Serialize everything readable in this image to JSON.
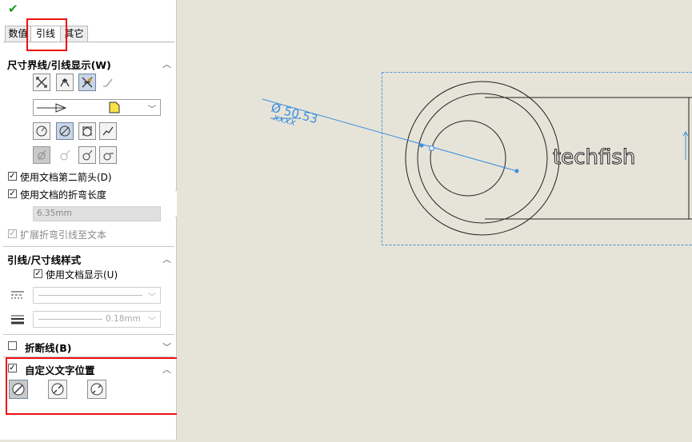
{
  "panel": {
    "ok_icon": "checkmark-icon",
    "tabs": [
      {
        "label": "数值"
      },
      {
        "label": "引线"
      },
      {
        "label": "其它"
      }
    ],
    "sec1": {
      "title": "尺寸界线/引线显示(W)",
      "arrow_combo_icon": "note-icon",
      "cb_second_arrow": "使用文档第二箭头(D)",
      "cb_bend_length": "使用文档的折弯长度",
      "bend_length_value": "6.35mm",
      "cb_extend_bend": "扩展折弯引线至文本"
    },
    "sec2": {
      "title": "引线/尺寸线样式",
      "cb_doc_display": "使用文档显示(U)",
      "line_thickness": "0.18mm"
    },
    "sec3": {
      "title": "折断线(B)"
    },
    "sec4": {
      "title": "自定义文字位置"
    }
  },
  "canvas": {
    "dim_value": "Ø 50.53",
    "dim_sub": "xxxx",
    "part_text": "techfish",
    "colors": {
      "dimension": "#3b8ee0",
      "selection_box": "#4a90d9",
      "geometry": "#222222",
      "highlight_box": "#ee1111"
    }
  }
}
